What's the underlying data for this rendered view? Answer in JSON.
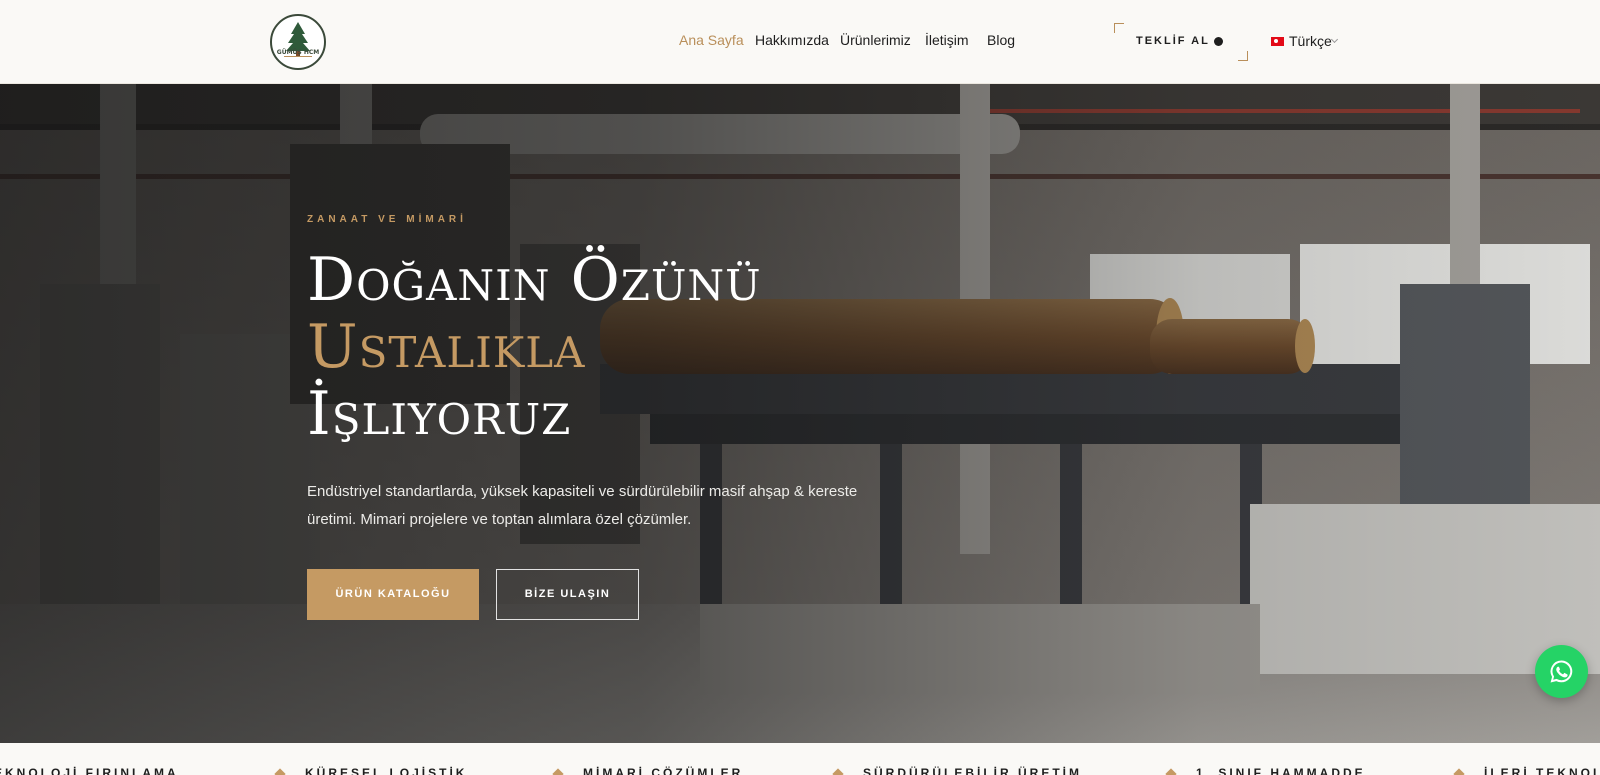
{
  "header": {
    "logo_text": "GÜMÜŞ HCM",
    "nav": [
      {
        "label": "Ana Sayfa",
        "active": true
      },
      {
        "label": "Hakkımızda",
        "active": false
      },
      {
        "label": "Ürünlerimiz",
        "active": false
      },
      {
        "label": "İletişim",
        "active": false
      },
      {
        "label": "Blog",
        "active": false
      }
    ],
    "quote_label": "TEKLİF AL",
    "language": "Türkçe"
  },
  "hero": {
    "eyebrow": "ZANAAT VE MİMARİ",
    "title_line1": "Doğanın Özünü",
    "title_line2": "Ustalıkla",
    "title_line3": "İşliyoruz",
    "description": "Endüstriyel standartlarda, yüksek kapasiteli ve sürdürülebilir masif ahşap & kereste üretimi. Mimari projelere ve toptan alımlara özel çözümler.",
    "primary_button": "ÜRÜN KATALOĞU",
    "secondary_button": "BİZE ULAŞIN"
  },
  "ticker": {
    "items": [
      "EKNOLOJİ FIRINLAMA",
      "KÜRESEL LOJİSTİK",
      "MİMARİ ÇÖZÜMLER",
      "SÜRDÜRÜLEBİLİR ÜRETİM",
      "1. SINIF HAMMADDE",
      "İLERİ TEKNOLOJİ"
    ]
  },
  "colors": {
    "accent": "#c59a63",
    "whatsapp": "#25d366",
    "text_dark": "#1e1e1e"
  },
  "icons": {
    "whatsapp": "whatsapp-icon",
    "flag": "turkey-flag-icon",
    "ticker_separator": "diamond-icon"
  }
}
